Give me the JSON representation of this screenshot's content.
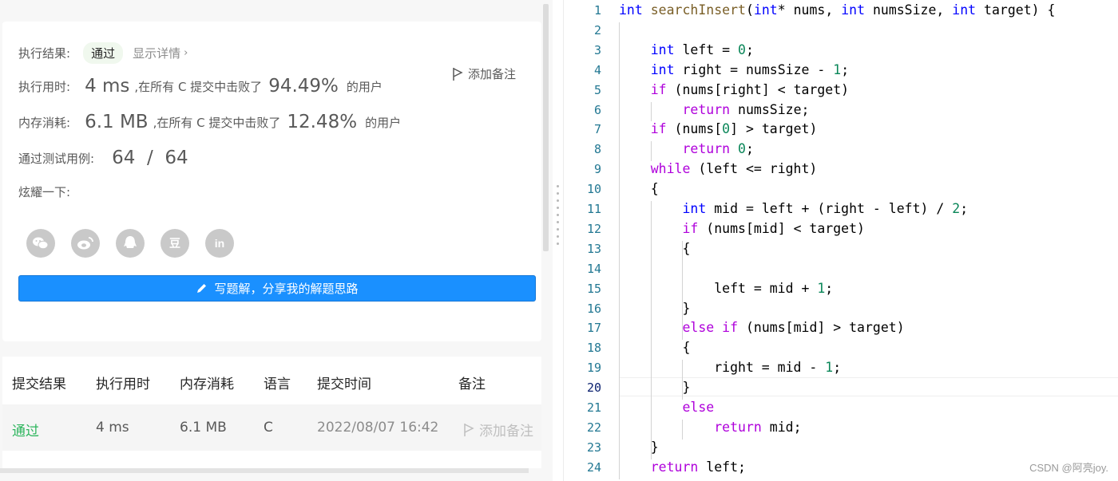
{
  "result": {
    "exec_result_label": "执行结果:",
    "status": "通过",
    "show_details": "显示详情",
    "add_note": "添加备注",
    "runtime_label": "执行用时:",
    "runtime_value": "4 ms",
    "runtime_mid": ",在所有 C 提交中击败了",
    "runtime_percent": "94.49%",
    "runtime_suffix": "的用户",
    "memory_label": "内存消耗:",
    "memory_value": "6.1 MB",
    "memory_mid": ",在所有 C 提交中击败了",
    "memory_percent": "12.48%",
    "memory_suffix": "的用户",
    "testcases_label": "通过测试用例:",
    "testcases_value": "64  /  64",
    "share_label": "炫耀一下:",
    "share_icons": [
      "wechat-icon",
      "weibo-icon",
      "qq-icon",
      "douban-icon",
      "linkedin-icon"
    ],
    "share_glyphs": {
      "douban": "豆",
      "linkedin": "in"
    },
    "write_solution": "写题解，分享我的解题思路"
  },
  "submissions": {
    "headers": [
      "提交结果",
      "执行用时",
      "内存消耗",
      "语言",
      "提交时间",
      "备注"
    ],
    "rows": [
      {
        "result": "通过",
        "runtime": "4 ms",
        "memory": "6.1 MB",
        "language": "C",
        "time": "2022/08/07 16:42",
        "note": "添加备注"
      }
    ]
  },
  "editor": {
    "current_line": 20,
    "line_numbers": [
      "1",
      "2",
      "3",
      "4",
      "5",
      "6",
      "7",
      "8",
      "9",
      "10",
      "11",
      "12",
      "13",
      "14",
      "15",
      "16",
      "17",
      "18",
      "19",
      "20",
      "21",
      "22",
      "23",
      "24"
    ],
    "lines": [
      "int searchInsert(int* nums, int numsSize, int target) {",
      "",
      "    int left = 0;",
      "    int right = numsSize - 1;",
      "    if (nums[right] < target)",
      "        return numsSize;",
      "    if (nums[0] > target)",
      "        return 0;",
      "    while (left <= right)",
      "    {",
      "        int mid = left + (right - left) / 2;",
      "        if (nums[mid] < target)",
      "        {",
      "",
      "            left = mid + 1;",
      "        }",
      "        else if (nums[mid] > target)",
      "        {",
      "            right = mid - 1;",
      "        }",
      "        else",
      "            return mid;",
      "    }",
      "    return left;"
    ]
  },
  "colors": {
    "accent": "#1a90ff",
    "pass_green": "#2db55d",
    "keyword": "#0000ff",
    "control": "#af00db",
    "number": "#098658",
    "function": "#795e26"
  },
  "watermark": "CSDN @阿亮joy."
}
